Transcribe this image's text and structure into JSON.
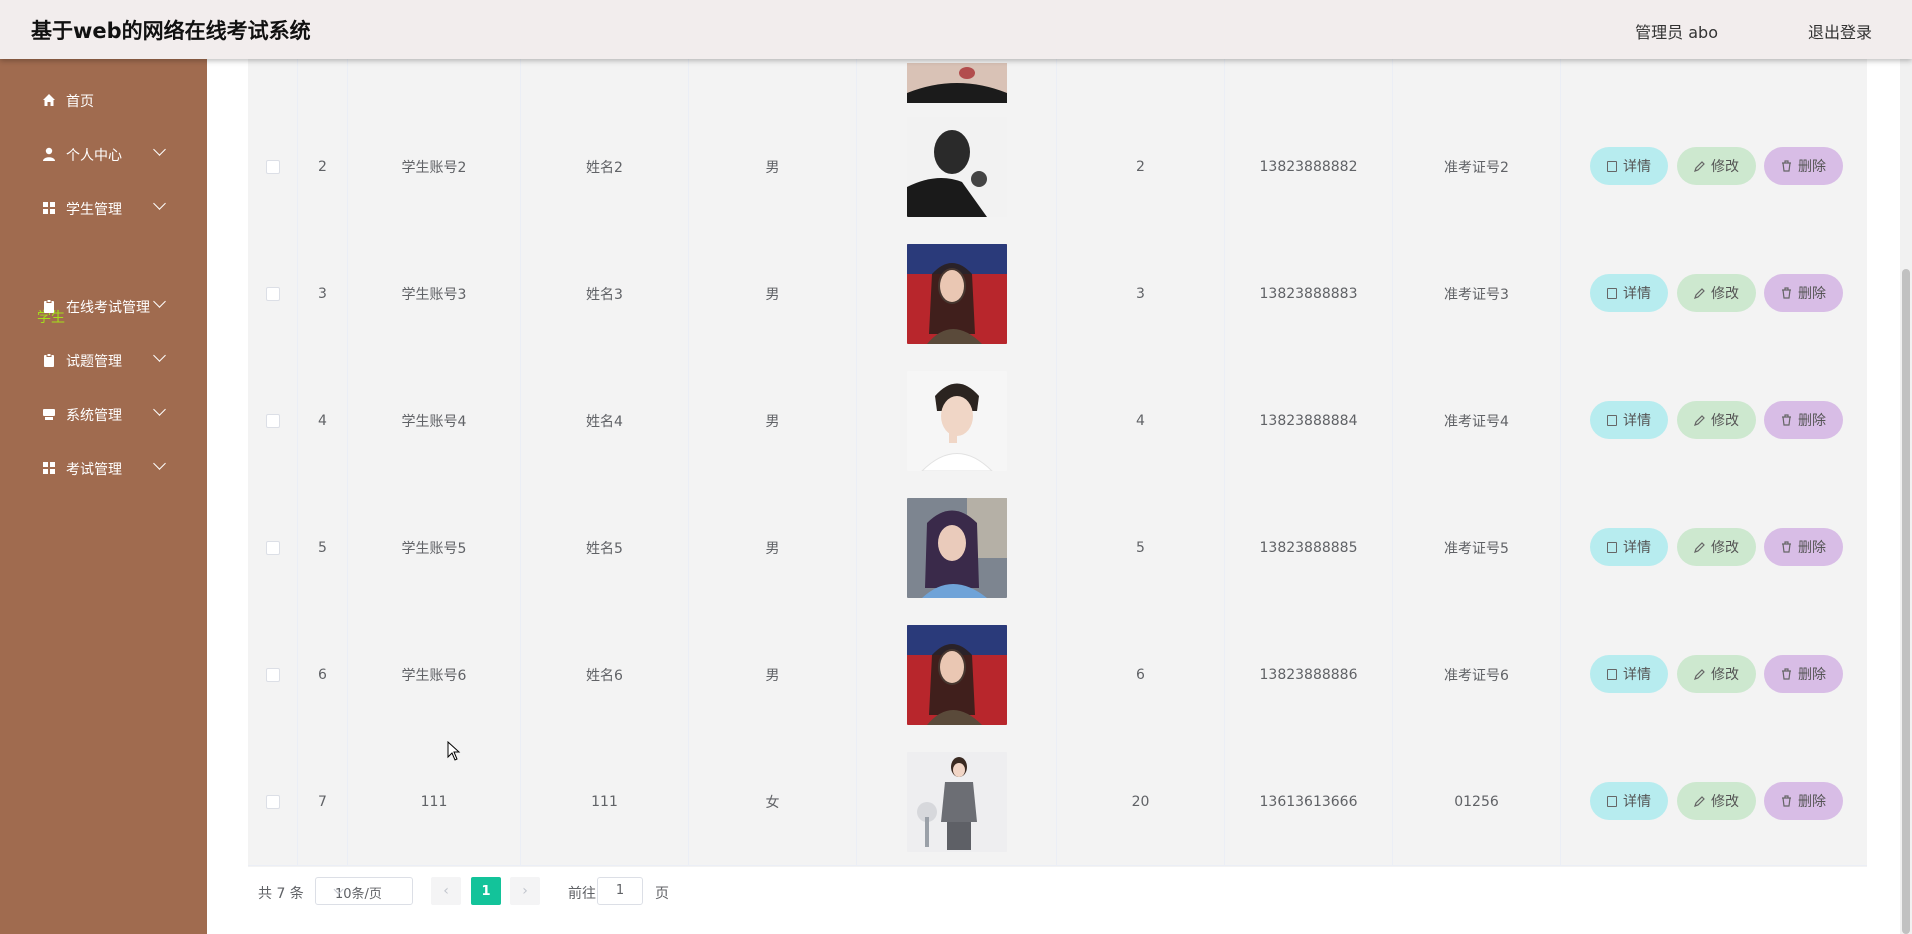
{
  "header": {
    "title": "基于web的网络在线考试系统",
    "user_label": "管理员 abo",
    "logout_label": "退出登录"
  },
  "sidebar": {
    "items": [
      {
        "label": "首页",
        "icon": "home-icon"
      },
      {
        "label": "个人中心",
        "icon": "user-icon"
      },
      {
        "label": "学生管理",
        "icon": "grid-icon"
      },
      {
        "label": "在线考试管理",
        "icon": "clipboard-icon"
      },
      {
        "label": "试题管理",
        "icon": "clipboard-icon"
      },
      {
        "label": "系统管理",
        "icon": "server-icon"
      },
      {
        "label": "考试管理",
        "icon": "grid-icon"
      }
    ],
    "active_sub": "学生"
  },
  "table": {
    "rows": [
      {
        "index": "2",
        "account": "学生账号2",
        "name": "姓名2",
        "gender": "男",
        "photo": "man-hand-chin-bw",
        "age": "2",
        "phone": "13823888882",
        "ticket": "准考证号2"
      },
      {
        "index": "3",
        "account": "学生账号3",
        "name": "姓名3",
        "gender": "男",
        "photo": "woman-red-background",
        "age": "3",
        "phone": "13823888883",
        "ticket": "准考证号3"
      },
      {
        "index": "4",
        "account": "学生账号4",
        "name": "姓名4",
        "gender": "男",
        "photo": "young-man-white-shirt",
        "age": "4",
        "phone": "13823888884",
        "ticket": "准考证号4"
      },
      {
        "index": "5",
        "account": "学生账号5",
        "name": "姓名5",
        "gender": "男",
        "photo": "woman-purple-hair",
        "age": "5",
        "phone": "13823888885",
        "ticket": "准考证号5"
      },
      {
        "index": "6",
        "account": "学生账号6",
        "name": "姓名6",
        "gender": "男",
        "photo": "woman-red-background",
        "age": "6",
        "phone": "13823888886",
        "ticket": "准考证号6"
      },
      {
        "index": "7",
        "account": "111",
        "name": "111",
        "gender": "女",
        "photo": "woman-grey-suit",
        "age": "20",
        "phone": "13613613666",
        "ticket": "01256"
      }
    ],
    "actions": {
      "detail": "详情",
      "edit": "修改",
      "delete": "删除"
    }
  },
  "pagination": {
    "total": "共 7 条",
    "page_size": "10条/页",
    "current_page": "1",
    "goto_prefix": "前往",
    "goto_value": "1",
    "goto_suffix": "页"
  }
}
